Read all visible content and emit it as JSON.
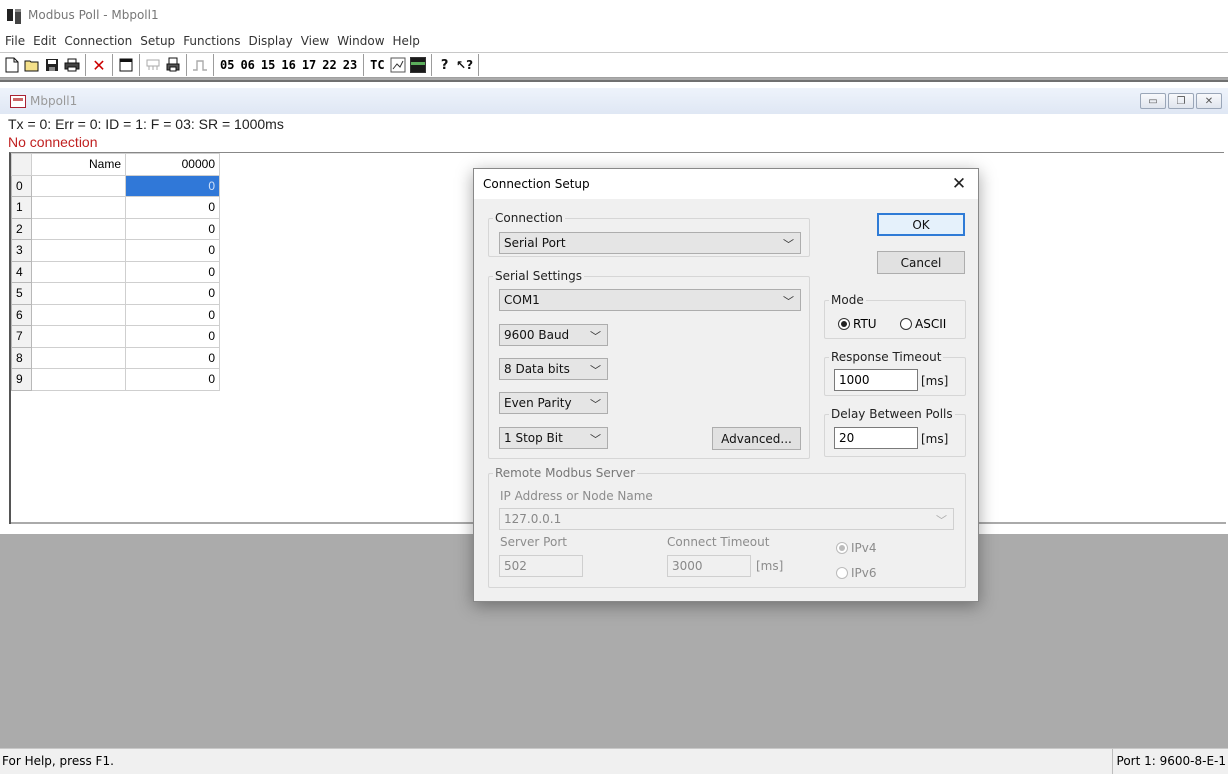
{
  "window": {
    "title": "Modbus Poll - Mbpoll1"
  },
  "menu": [
    "File",
    "Edit",
    "Connection",
    "Setup",
    "Functions",
    "Display",
    "View",
    "Window",
    "Help"
  ],
  "toolbar": {
    "function_codes": [
      "05",
      "06",
      "15",
      "16",
      "17",
      "22",
      "23"
    ],
    "tc_label": "TC",
    "help_glyph": "?",
    "context_help_glyph": "↖?"
  },
  "child": {
    "title": "Mbpoll1",
    "status_line": "Tx = 0: Err = 0: ID = 1: F = 03: SR = 1000ms",
    "connection_state": "No connection",
    "grid": {
      "name_header": "Name",
      "address_header": "00000",
      "rows": [
        {
          "index": "0",
          "name": "",
          "value": "0"
        },
        {
          "index": "1",
          "name": "",
          "value": "0"
        },
        {
          "index": "2",
          "name": "",
          "value": "0"
        },
        {
          "index": "3",
          "name": "",
          "value": "0"
        },
        {
          "index": "4",
          "name": "",
          "value": "0"
        },
        {
          "index": "5",
          "name": "",
          "value": "0"
        },
        {
          "index": "6",
          "name": "",
          "value": "0"
        },
        {
          "index": "7",
          "name": "",
          "value": "0"
        },
        {
          "index": "8",
          "name": "",
          "value": "0"
        },
        {
          "index": "9",
          "name": "",
          "value": "0"
        }
      ]
    }
  },
  "dialog": {
    "title": "Connection Setup",
    "close_glyph": "✕",
    "connection": {
      "legend": "Connection",
      "value": "Serial Port"
    },
    "serial": {
      "legend": "Serial Settings",
      "port": "COM1",
      "baud": "9600 Baud",
      "data_bits": "8 Data bits",
      "parity": "Even Parity",
      "stop_bits": "1 Stop Bit",
      "advanced_label": "Advanced..."
    },
    "ok_label": "OK",
    "cancel_label": "Cancel",
    "mode": {
      "legend": "Mode",
      "rtu": "RTU",
      "ascii": "ASCII",
      "selected": "RTU"
    },
    "response_timeout": {
      "legend": "Response Timeout",
      "value": "1000",
      "unit": "[ms]"
    },
    "delay_between_polls": {
      "legend": "Delay Between Polls",
      "value": "20",
      "unit": "[ms]"
    },
    "remote": {
      "legend": "Remote Modbus Server",
      "ip_label": "IP Address or Node Name",
      "ip_value": "127.0.0.1",
      "port_label": "Server Port",
      "port_value": "502",
      "connect_timeout_label": "Connect Timeout",
      "connect_timeout_value": "3000",
      "unit": "[ms]",
      "ipv4": "IPv4",
      "ipv6": "IPv6"
    }
  },
  "statusbar": {
    "help": "For Help, press F1.",
    "port": "Port 1: 9600-8-E-1"
  },
  "colors": {
    "selection": "#3078d8",
    "error_text": "#c02020",
    "default_button_border": "#2f7bd6",
    "workspace": "#ababab"
  }
}
